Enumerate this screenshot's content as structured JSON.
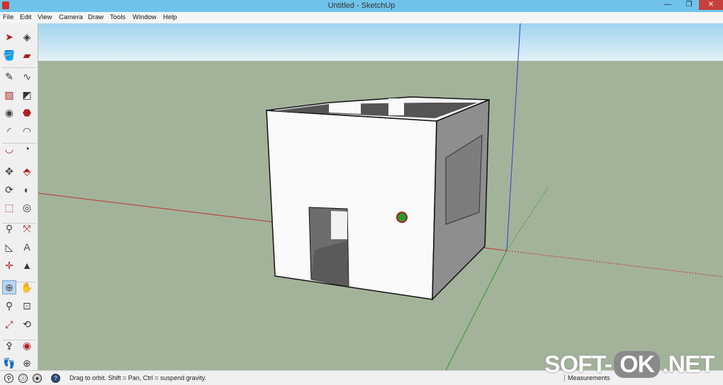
{
  "window": {
    "title": "Untitled - SketchUp",
    "minimize": "—",
    "restore": "❐",
    "close": "✕"
  },
  "menu": [
    "File",
    "Edit",
    "View",
    "Camera",
    "Draw",
    "Tools",
    "Window",
    "Help"
  ],
  "tools": [
    {
      "name": "select",
      "glyph": "➤"
    },
    {
      "name": "make-component",
      "glyph": "◈"
    },
    {
      "name": "paint-bucket",
      "glyph": "🪣"
    },
    {
      "name": "eraser",
      "glyph": "▰"
    },
    {
      "name": "line",
      "glyph": "✎"
    },
    {
      "name": "freehand",
      "glyph": "∿"
    },
    {
      "name": "rectangle",
      "glyph": "▨"
    },
    {
      "name": "rotated-rectangle",
      "glyph": "◩"
    },
    {
      "name": "circle",
      "glyph": "◉"
    },
    {
      "name": "polygon",
      "glyph": "⬣"
    },
    {
      "name": "arc",
      "glyph": "◜"
    },
    {
      "name": "two-point-arc",
      "glyph": "◠"
    },
    {
      "name": "three-point-arc",
      "glyph": "◡"
    },
    {
      "name": "pie",
      "glyph": "◔"
    },
    {
      "name": "move",
      "glyph": "✥"
    },
    {
      "name": "push-pull",
      "glyph": "⬘"
    },
    {
      "name": "rotate",
      "glyph": "⟳"
    },
    {
      "name": "follow-me",
      "glyph": "◐"
    },
    {
      "name": "scale",
      "glyph": "⬚"
    },
    {
      "name": "offset",
      "glyph": "◎"
    },
    {
      "name": "tape-measure",
      "glyph": "⚲"
    },
    {
      "name": "dimension",
      "glyph": "⤧"
    },
    {
      "name": "protractor",
      "glyph": "◺"
    },
    {
      "name": "text",
      "glyph": "A"
    },
    {
      "name": "axes",
      "glyph": "✛"
    },
    {
      "name": "3d-text",
      "glyph": "▲"
    },
    {
      "name": "orbit",
      "glyph": "⊕",
      "active": true
    },
    {
      "name": "pan",
      "glyph": "✋"
    },
    {
      "name": "zoom",
      "glyph": "⚲"
    },
    {
      "name": "zoom-window",
      "glyph": "⊡"
    },
    {
      "name": "zoom-extents",
      "glyph": "⤢"
    },
    {
      "name": "previous-view",
      "glyph": "⟲"
    },
    {
      "name": "position-camera",
      "glyph": "⚴"
    },
    {
      "name": "look-around",
      "glyph": "◉"
    },
    {
      "name": "walk",
      "glyph": "👣"
    },
    {
      "name": "section-plane",
      "glyph": "⊕"
    }
  ],
  "status": {
    "text": "Drag to orbit. Shift = Pan, Ctrl = suspend gravity.",
    "measurements_label": "Measurements",
    "help_glyph": "?"
  },
  "watermark": {
    "left": "SOFT-",
    "ok": "OK",
    "right": ".NET"
  },
  "colors": {
    "sky_top": "#9fd3ee",
    "sky_bottom": "#e4f1f6",
    "ground": "#a3b39a",
    "x_axis": "#c03030",
    "y_axis": "#2a9a2a",
    "z_axis": "#2b3fd0"
  }
}
